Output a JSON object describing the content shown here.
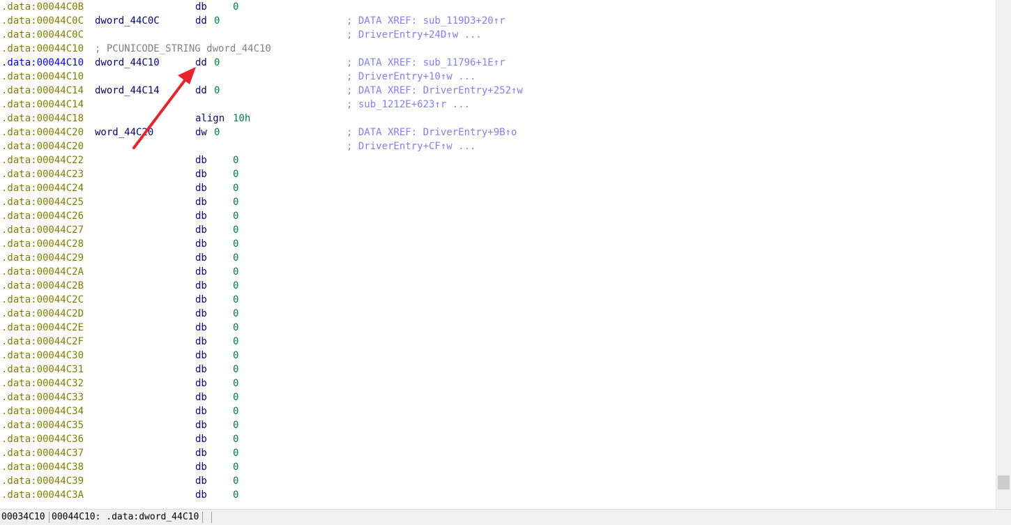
{
  "listing": {
    "lines": [
      {
        "addr": ".data:00044C0B",
        "label": "",
        "mnem": "db",
        "opnd": "0",
        "kind": "db",
        "xref": ""
      },
      {
        "addr": ".data:00044C0C",
        "label": "dword_44C0C",
        "mnem": "dd",
        "opnd": "0",
        "kind": "dd",
        "xref": "; DATA XREF: sub_119D3+20↑r"
      },
      {
        "addr": ".data:00044C0C",
        "label": "",
        "mnem": "",
        "opnd": "",
        "kind": "cont",
        "xref": "; DriverEntry+24D↑w ..."
      },
      {
        "addr": ".data:00044C10",
        "label": "; PCUNICODE_STRING dword_44C10",
        "mnem": "",
        "opnd": "",
        "kind": "comment",
        "xref": ""
      },
      {
        "addr": ".data:00044C10",
        "label": "dword_44C10",
        "mnem": "dd",
        "opnd": "0",
        "kind": "dd",
        "xref": "; DATA XREF: sub_11796+1E↑r",
        "current": true
      },
      {
        "addr": ".data:00044C10",
        "label": "",
        "mnem": "",
        "opnd": "",
        "kind": "cont",
        "xref": "; DriverEntry+10↑w ..."
      },
      {
        "addr": ".data:00044C14",
        "label": "dword_44C14",
        "mnem": "dd",
        "opnd": "0",
        "kind": "dd",
        "xref": "; DATA XREF: DriverEntry+252↑w"
      },
      {
        "addr": ".data:00044C14",
        "label": "",
        "mnem": "",
        "opnd": "",
        "kind": "cont",
        "xref": "; sub_1212E+623↑r ..."
      },
      {
        "addr": ".data:00044C18",
        "label": "",
        "mnem": "align",
        "opnd": "10h",
        "kind": "align",
        "xref": ""
      },
      {
        "addr": ".data:00044C20",
        "label": "word_44C20",
        "mnem": "dw",
        "opnd": "0",
        "kind": "dd",
        "xref": "; DATA XREF: DriverEntry+9B↑o"
      },
      {
        "addr": ".data:00044C20",
        "label": "",
        "mnem": "",
        "opnd": "",
        "kind": "cont",
        "xref": "; DriverEntry+CF↑w ..."
      },
      {
        "addr": ".data:00044C22",
        "label": "",
        "mnem": "db",
        "opnd": "0",
        "kind": "db",
        "xref": ""
      },
      {
        "addr": ".data:00044C23",
        "label": "",
        "mnem": "db",
        "opnd": "0",
        "kind": "db",
        "xref": ""
      },
      {
        "addr": ".data:00044C24",
        "label": "",
        "mnem": "db",
        "opnd": "0",
        "kind": "db",
        "xref": ""
      },
      {
        "addr": ".data:00044C25",
        "label": "",
        "mnem": "db",
        "opnd": "0",
        "kind": "db",
        "xref": ""
      },
      {
        "addr": ".data:00044C26",
        "label": "",
        "mnem": "db",
        "opnd": "0",
        "kind": "db",
        "xref": ""
      },
      {
        "addr": ".data:00044C27",
        "label": "",
        "mnem": "db",
        "opnd": "0",
        "kind": "db",
        "xref": ""
      },
      {
        "addr": ".data:00044C28",
        "label": "",
        "mnem": "db",
        "opnd": "0",
        "kind": "db",
        "xref": ""
      },
      {
        "addr": ".data:00044C29",
        "label": "",
        "mnem": "db",
        "opnd": "0",
        "kind": "db",
        "xref": ""
      },
      {
        "addr": ".data:00044C2A",
        "label": "",
        "mnem": "db",
        "opnd": "0",
        "kind": "db",
        "xref": ""
      },
      {
        "addr": ".data:00044C2B",
        "label": "",
        "mnem": "db",
        "opnd": "0",
        "kind": "db",
        "xref": ""
      },
      {
        "addr": ".data:00044C2C",
        "label": "",
        "mnem": "db",
        "opnd": "0",
        "kind": "db",
        "xref": ""
      },
      {
        "addr": ".data:00044C2D",
        "label": "",
        "mnem": "db",
        "opnd": "0",
        "kind": "db",
        "xref": ""
      },
      {
        "addr": ".data:00044C2E",
        "label": "",
        "mnem": "db",
        "opnd": "0",
        "kind": "db",
        "xref": ""
      },
      {
        "addr": ".data:00044C2F",
        "label": "",
        "mnem": "db",
        "opnd": "0",
        "kind": "db",
        "xref": ""
      },
      {
        "addr": ".data:00044C30",
        "label": "",
        "mnem": "db",
        "opnd": "0",
        "kind": "db",
        "xref": ""
      },
      {
        "addr": ".data:00044C31",
        "label": "",
        "mnem": "db",
        "opnd": "0",
        "kind": "db",
        "xref": ""
      },
      {
        "addr": ".data:00044C32",
        "label": "",
        "mnem": "db",
        "opnd": "0",
        "kind": "db",
        "xref": ""
      },
      {
        "addr": ".data:00044C33",
        "label": "",
        "mnem": "db",
        "opnd": "0",
        "kind": "db",
        "xref": ""
      },
      {
        "addr": ".data:00044C34",
        "label": "",
        "mnem": "db",
        "opnd": "0",
        "kind": "db",
        "xref": ""
      },
      {
        "addr": ".data:00044C35",
        "label": "",
        "mnem": "db",
        "opnd": "0",
        "kind": "db",
        "xref": ""
      },
      {
        "addr": ".data:00044C36",
        "label": "",
        "mnem": "db",
        "opnd": "0",
        "kind": "db",
        "xref": ""
      },
      {
        "addr": ".data:00044C37",
        "label": "",
        "mnem": "db",
        "opnd": "0",
        "kind": "db",
        "xref": ""
      },
      {
        "addr": ".data:00044C38",
        "label": "",
        "mnem": "db",
        "opnd": "0",
        "kind": "db",
        "xref": ""
      },
      {
        "addr": ".data:00044C39",
        "label": "",
        "mnem": "db",
        "opnd": "0",
        "kind": "db",
        "xref": ""
      },
      {
        "addr": ".data:00044C3A",
        "label": "",
        "mnem": "db",
        "opnd": "0",
        "kind": "db",
        "xref": ""
      }
    ]
  },
  "statusbar": {
    "file_offset": "00034C10",
    "location": "00044C10: .data:dword_44C10"
  },
  "annotation": {
    "arrow_color": "#e8232a"
  }
}
